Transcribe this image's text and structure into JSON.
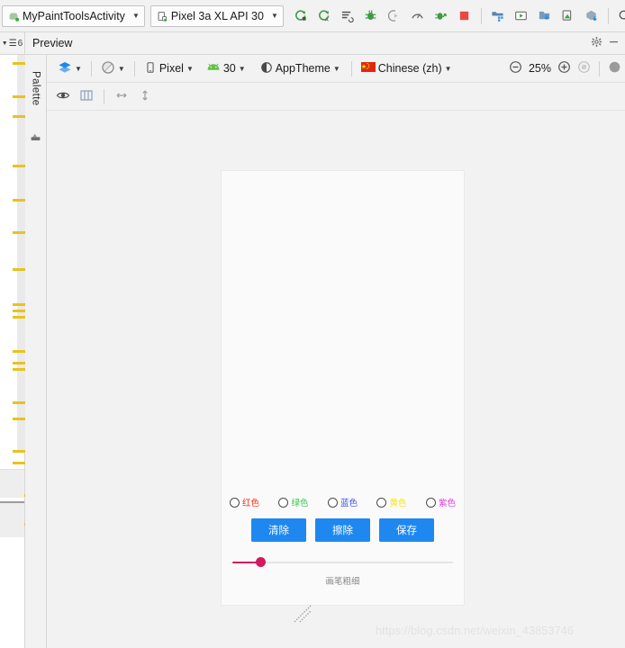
{
  "window": {
    "run_config": {
      "label": "MyPaintToolsActivity",
      "icon": "android-activity-icon"
    },
    "device_target": {
      "label": "Pixel 3a XL API 30",
      "icon": "device-phone-icon"
    },
    "toolbar_icons": [
      {
        "name": "run-icon",
        "title": "Run"
      },
      {
        "name": "apply-changes-icon",
        "title": "Apply Changes"
      },
      {
        "name": "apply-code-changes-icon",
        "title": "Apply Code Changes"
      },
      {
        "name": "debug-icon",
        "title": "Debug"
      },
      {
        "name": "attach-debugger-icon",
        "title": "Attach Debugger to Android Process"
      },
      {
        "name": "profiler-icon",
        "title": "Profile"
      },
      {
        "name": "run-with-coverage-icon",
        "title": "Run with Coverage"
      },
      {
        "name": "stop-icon",
        "title": "Stop"
      },
      {
        "name": "sdk-manager-icon",
        "title": "SDK Manager"
      },
      {
        "name": "avd-manager-icon",
        "title": "AVD Manager"
      },
      {
        "name": "device-file-explorer-icon",
        "title": "Device File Explorer"
      },
      {
        "name": "layout-inspector-icon",
        "title": "Layout Inspector"
      },
      {
        "name": "gradle-sync-icon",
        "title": "Sync Project with Gradle Files"
      },
      {
        "name": "search-everywhere-icon",
        "title": "Search Everywhere"
      }
    ]
  },
  "editor": {
    "lines_badge": "6",
    "collapse_icon": "chevron-down-icon",
    "lines_icon": "lines-icon"
  },
  "preview": {
    "title": "Preview",
    "settings_icon": "gear-icon",
    "minimize_icon": "minimize-icon"
  },
  "palette": {
    "label": "Palette",
    "icon": "component-tree-icon"
  },
  "design_toolbar": {
    "design_mode": {
      "label": "",
      "icon": "layers-icon"
    },
    "orientation": {
      "label": "",
      "icon": "rotate-icon"
    },
    "device": {
      "label": "Pixel",
      "icon": "phone-icon"
    },
    "api_level": {
      "label": "30",
      "icon": "android-icon"
    },
    "theme": {
      "label": "AppTheme",
      "icon": "theme-contrast-icon"
    },
    "locale": {
      "label": "Chinese (zh)",
      "icon": "flag-cn-icon"
    },
    "zoom_out_icon": "zoom-out-icon",
    "zoom_level": "25%",
    "zoom_in_icon": "zoom-in-icon",
    "zoom_fit_icon": "zoom-fit-icon",
    "more_icon": "more-icon"
  },
  "design_toolbar2": {
    "items": [
      {
        "name": "toggle-visibility-icon",
        "title": "Toggle Visibility"
      },
      {
        "name": "blueprint-columns-icon",
        "title": "Show Layout Decorations"
      },
      {
        "name": "horizontal-constraint-icon",
        "title": "Horizontal Bias"
      },
      {
        "name": "vertical-constraint-icon",
        "title": "Vertical Bias"
      }
    ]
  },
  "device_preview": {
    "radio_group": {
      "name": "color-radio-group",
      "options": [
        {
          "label": "红色",
          "color": "#ff2a0b",
          "selected": false
        },
        {
          "label": "绿色",
          "color": "#31cc46",
          "selected": false
        },
        {
          "label": "蓝色",
          "color": "#3653f0",
          "selected": false
        },
        {
          "label": "黄色",
          "color": "#f2e71b",
          "selected": false
        },
        {
          "label": "紫色",
          "color": "#e03ae0",
          "selected": false
        }
      ]
    },
    "buttons": [
      {
        "label": "清除",
        "name": "clear-button"
      },
      {
        "label": "擦除",
        "name": "erase-button"
      },
      {
        "label": "保存",
        "name": "save-button"
      }
    ],
    "slider": {
      "caption": "画笔粗细",
      "value_pct": 11,
      "accent_color": "#d3185f",
      "track_color": "#e4e4e4"
    },
    "canvas_color": "#fafafa"
  },
  "watermark": {
    "text": "https://blog.csdn.net/weixin_43853746"
  },
  "colors": {
    "toolbar_bg": "#f2f2f2",
    "accent_blue": "#1e88f0",
    "minimap_mark": "#e8c31e",
    "green_run": "#3c9a40"
  }
}
